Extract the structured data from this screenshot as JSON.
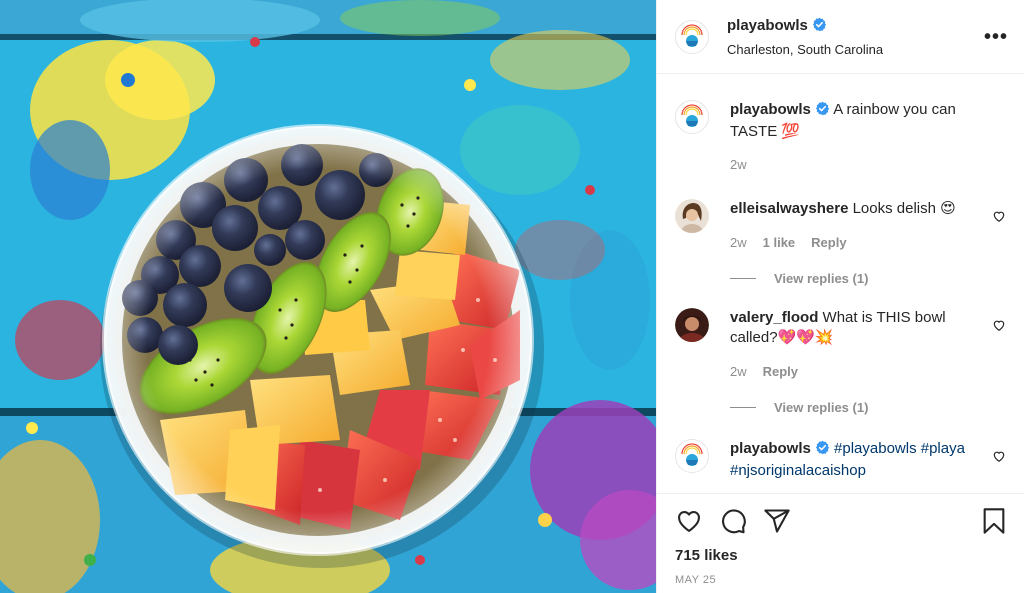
{
  "colors": {
    "accent_blue": "#0095f6",
    "verified": "#3897f0",
    "text": "#262626",
    "muted": "#8e8e8e",
    "link": "#00376b"
  },
  "header": {
    "username": "playabowls",
    "location": "Charleston, South Carolina",
    "more_label": "•••"
  },
  "caption": {
    "username": "playabowls",
    "text": "A rainbow you can TASTE 💯",
    "time": "2w"
  },
  "comments": [
    {
      "username": "elleisalwayshere",
      "text": "Looks delish 😍",
      "time": "2w",
      "likes": "1 like",
      "reply": "Reply",
      "view_replies": "View replies (1)"
    },
    {
      "username": "valery_flood",
      "text": "What is THIS bowl called?💖💖💥",
      "time": "2w",
      "reply": "Reply",
      "view_replies": "View replies (1)"
    },
    {
      "username": "playabowls",
      "text": "#playabowls #playa #njsoriginalacaishop"
    }
  ],
  "icons": [
    "heart-icon",
    "comment-icon",
    "share-icon",
    "bookmark-icon",
    "verified-icon",
    "more-icon"
  ],
  "post": {
    "likes": "715 likes",
    "date": "MAY 25"
  }
}
